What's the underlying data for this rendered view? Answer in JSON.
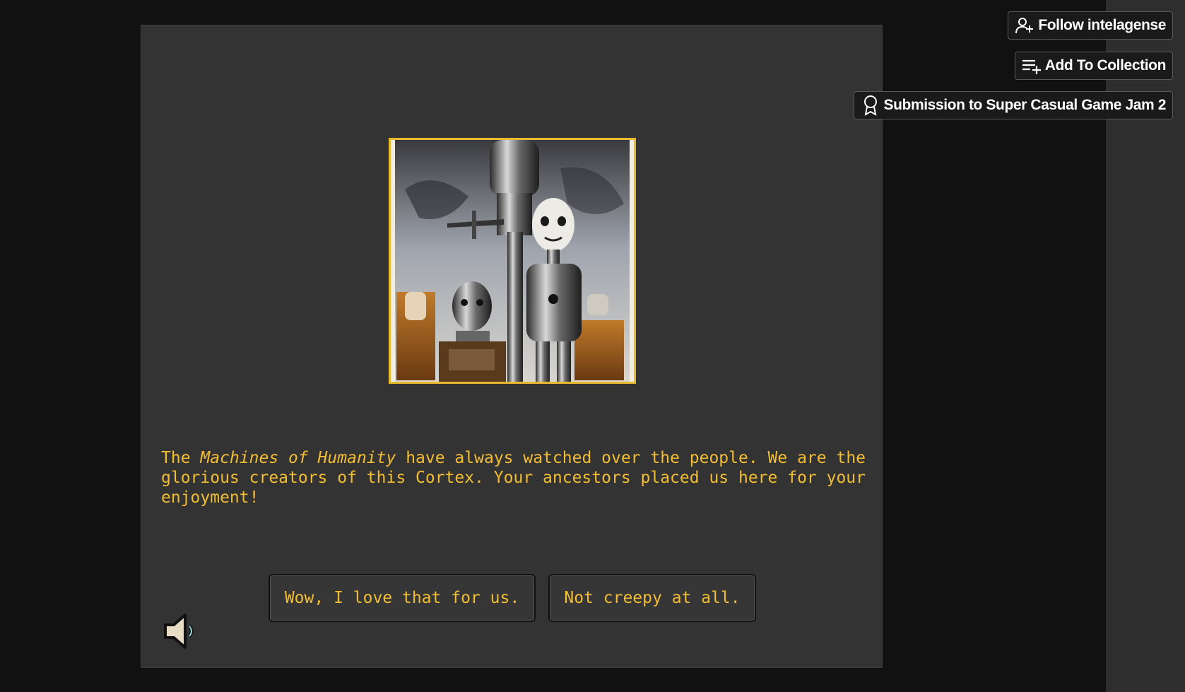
{
  "header_buttons": {
    "follow_label": "Follow intelagense",
    "follow_icon": "user-plus-icon",
    "collection_label": "Add To Collection",
    "collection_icon": "playlist-add-icon",
    "jam_label": "Submission to Super Casual Game Jam 2",
    "jam_icon": "award-ribbon-icon"
  },
  "game": {
    "portrait_icon": "robots-portrait-image",
    "story": {
      "prefix": "The ",
      "emphasis": "Machines of Humanity",
      "suffix": " have always watched over the people. We are the glorious creators of this Cortex. Your ancestors placed us here for your enjoyment!"
    },
    "choices": [
      {
        "label": "Wow, I love that for us."
      },
      {
        "label": "Not creepy at all."
      }
    ],
    "sound_icon": "speaker-icon"
  },
  "colors": {
    "text_accent": "#f2bd33",
    "frame_border": "#e9b92f",
    "panel_bg": "#333333",
    "page_bg": "#111111"
  }
}
